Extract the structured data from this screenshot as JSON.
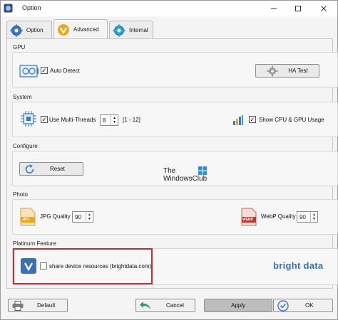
{
  "window": {
    "title": "Option"
  },
  "tabs": [
    {
      "label": "Option",
      "active": false
    },
    {
      "label": "Advanced",
      "active": true
    },
    {
      "label": "Internal",
      "active": false
    }
  ],
  "gpu": {
    "group_label": "GPU",
    "auto_detect_label": "Auto Detect",
    "auto_detect_checked": true,
    "ha_test_label": "HA Test"
  },
  "system": {
    "group_label": "System",
    "multithreads_label": "Use Multi-Threads",
    "multithreads_checked": true,
    "threads_value": "8",
    "threads_range": "[1 - 12]",
    "show_usage_label": "Show CPU & GPU Usage",
    "show_usage_checked": true
  },
  "configure": {
    "group_label": "Configure",
    "reset_label": "Reset"
  },
  "watermark": {
    "line1": "The",
    "line2": "WindowsClub"
  },
  "photo": {
    "group_label": "Photo",
    "jpg_label": "JPG Quality",
    "jpg_value": "90",
    "jpg_icon_text": "JPG",
    "webp_label": "WebP Quality",
    "webp_value": "90",
    "webp_icon_text": "WEBP"
  },
  "platinum": {
    "group_label": "Platinum Feature",
    "share_label": "share device resources (brightdata.com)",
    "share_checked": false,
    "brand": "bright data"
  },
  "footer": {
    "default_label": "Default",
    "cancel_label": "Cancel",
    "apply_label": "Apply",
    "ok_label": "OK"
  },
  "colors": {
    "highlight_red": "#d0282e",
    "brand_blue": "#3b6fb6",
    "accent_orange": "#f2a71b",
    "apply_gray": "#bdbdbd"
  }
}
